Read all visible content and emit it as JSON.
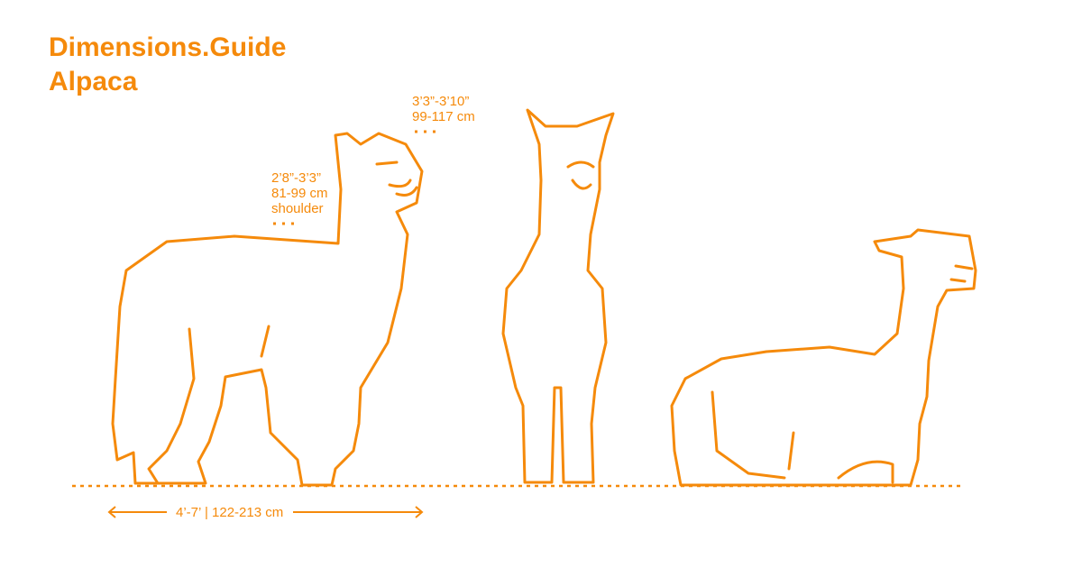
{
  "brand": {
    "site": "Dimensions.Guide",
    "subject": "Alpaca"
  },
  "labels": {
    "head_height_ft": "3’3”-3’10”",
    "head_height_cm": "99-117 cm",
    "shoulder_height_ft": "2’8”-3’3”",
    "shoulder_height_cm": "81-99 cm",
    "shoulder_label": "shoulder",
    "length": "4’-7’ | 122-213 cm"
  },
  "colors": {
    "accent": "#f58a0b"
  }
}
